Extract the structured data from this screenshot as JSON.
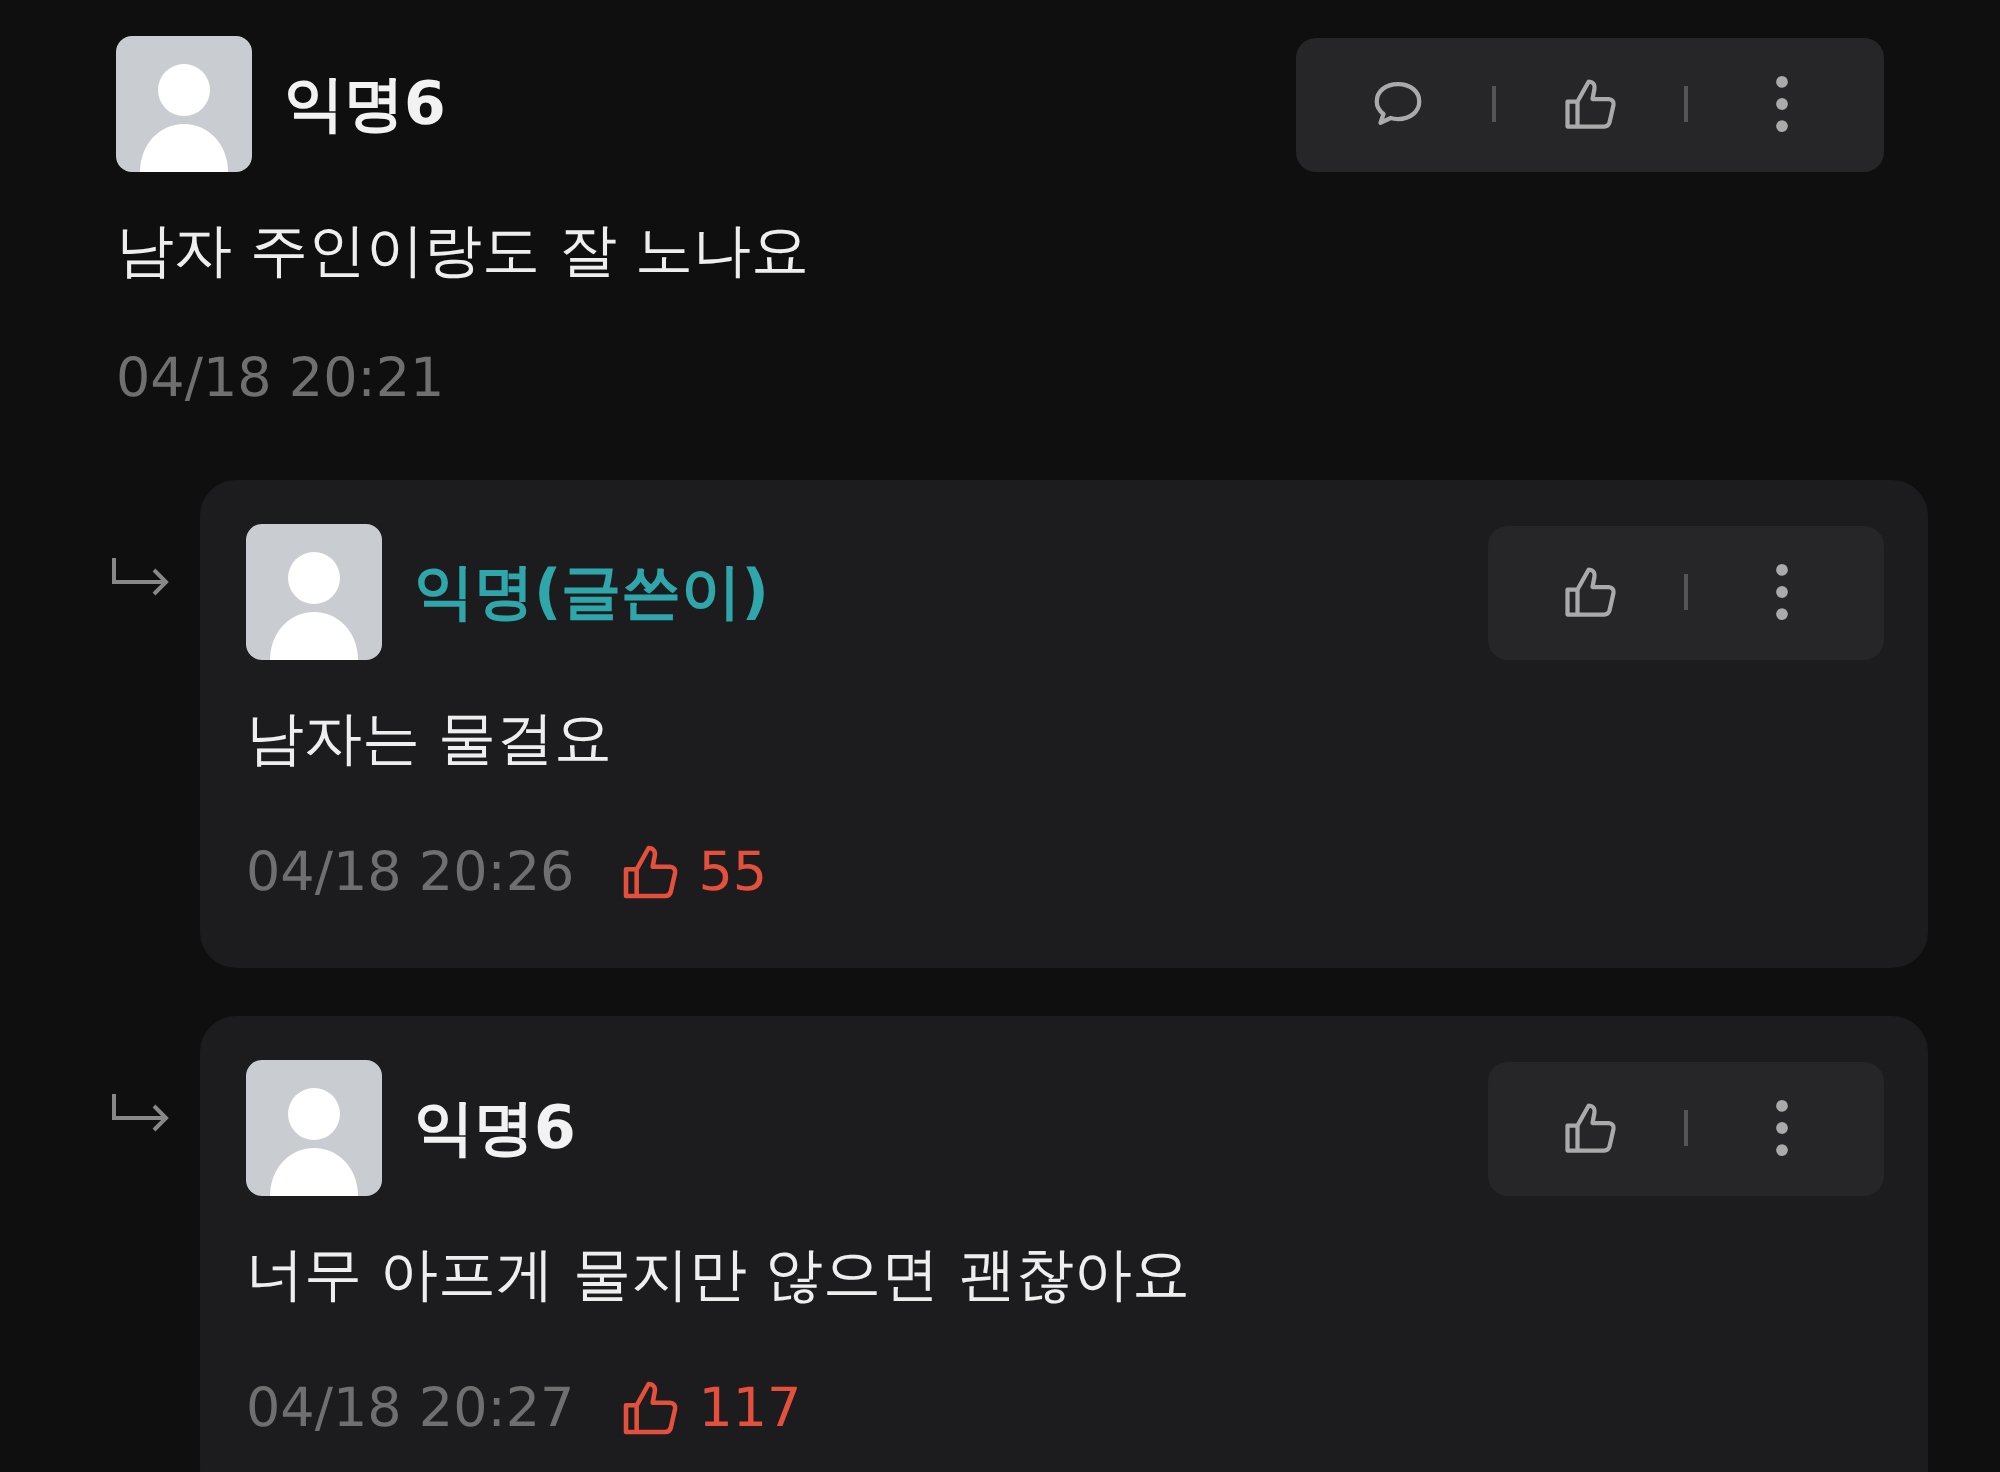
{
  "comments": [
    {
      "author": "익명6",
      "is_writer": false,
      "text": "남자 주인이랑도 잘 노나요",
      "time": "04/18 20:21",
      "actions": [
        {
          "kind": "reply"
        },
        {
          "kind": "like"
        },
        {
          "kind": "more"
        }
      ],
      "replies": [
        {
          "author": "익명(글쓴이)",
          "is_writer": true,
          "text": "남자는 물걸요",
          "time": "04/18 20:26",
          "likes": "55",
          "actions": [
            {
              "kind": "like"
            },
            {
              "kind": "more"
            }
          ]
        },
        {
          "author": "익명6",
          "is_writer": false,
          "text": "너무 아프게 물지만 않으면 괜찮아요",
          "time": "04/18 20:27",
          "likes": "117",
          "actions": [
            {
              "kind": "like"
            },
            {
              "kind": "more"
            }
          ]
        }
      ]
    }
  ]
}
